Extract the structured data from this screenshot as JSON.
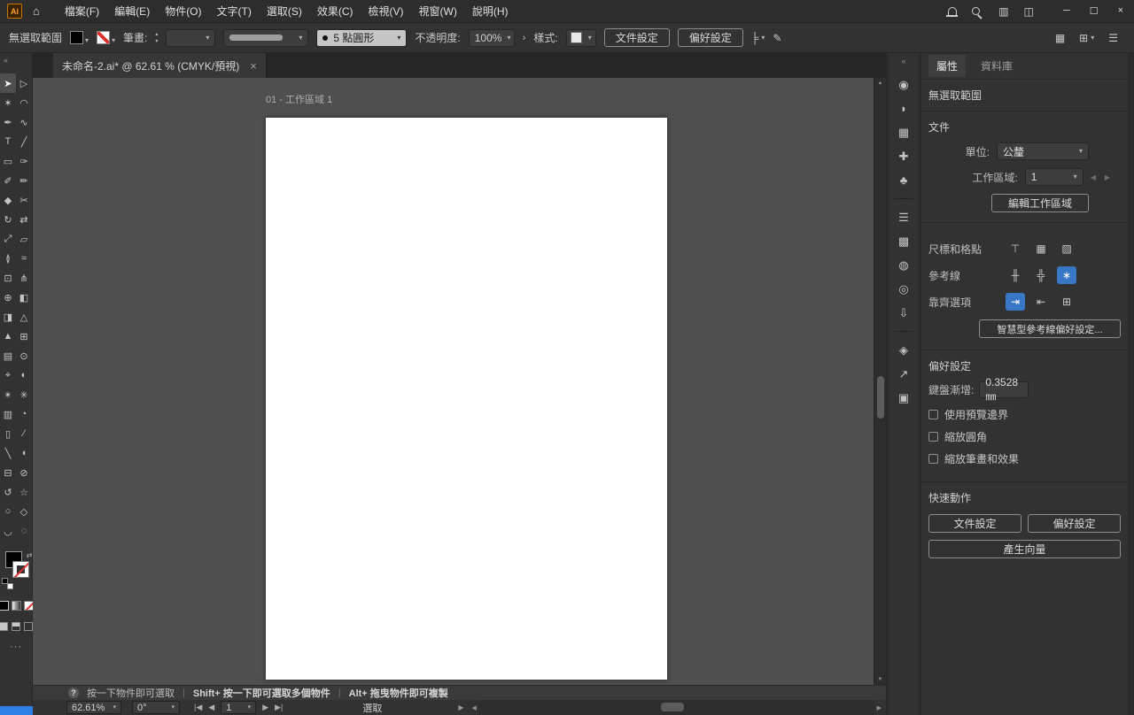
{
  "icons": {
    "logo": "Ai",
    "home": "⌂",
    "collapse": "«",
    "caret": "▾",
    "minimize": "─",
    "maximize": "☐",
    "close": "×",
    "tab_close": "×",
    "help": "?",
    "layout_a": "▥",
    "layout_b": "◫",
    "stepper_up": "▴",
    "stepper_down": "▾",
    "opacity_more": "›",
    "align": "╞",
    "edit": "✎",
    "arrange_documents": "▦",
    "workspace": "⊞",
    "bar_menu": "☰",
    "divider": "|",
    "nav_first": "|◀",
    "nav_prev": "◀",
    "nav_next": "▶",
    "nav_last": "▶|",
    "scroll_left": "◀",
    "scroll_right": "▶",
    "scroll_up": "▲",
    "scroll_down": "▼",
    "panel_prev": "◀",
    "panel_next": "▶",
    "swap": "⇄",
    "ellipsis": "···"
  },
  "menubar": {
    "items": [
      "檔案(F)",
      "編輯(E)",
      "物件(O)",
      "文字(T)",
      "選取(S)",
      "效果(C)",
      "檢視(V)",
      "視窗(W)",
      "說明(H)"
    ]
  },
  "control_bar": {
    "selection_label": "無選取範圍",
    "stroke_label": "筆畫:",
    "brush_value": "5 點圓形",
    "opacity_label": "不透明度:",
    "opacity_value": "100%",
    "style_label": "樣式:",
    "document_setup": "文件設定",
    "preferences": "偏好設定"
  },
  "document_tab": {
    "title": "未命名-2.ai* @ 62.61 % (CMYK/預視)"
  },
  "canvas": {
    "artboard_label": "01 - 工作區域 1"
  },
  "toolbar": {
    "tools": [
      {
        "name": "selection-tool",
        "glyph": "➤",
        "active": true
      },
      {
        "name": "direct-selection-tool",
        "glyph": "▷"
      },
      {
        "name": "magic-wand-tool",
        "glyph": "✶"
      },
      {
        "name": "lasso-tool",
        "glyph": "◠"
      },
      {
        "name": "pen-tool",
        "glyph": "✒"
      },
      {
        "name": "curvature-tool",
        "glyph": "∿"
      },
      {
        "name": "type-tool",
        "glyph": "T"
      },
      {
        "name": "line-segment-tool",
        "glyph": "╱"
      },
      {
        "name": "rectangle-tool",
        "glyph": "▭"
      },
      {
        "name": "paintbrush-tool",
        "glyph": "✑"
      },
      {
        "name": "shaper-tool",
        "glyph": "✐"
      },
      {
        "name": "pencil-tool",
        "glyph": "✏"
      },
      {
        "name": "eraser-tool",
        "glyph": "◆"
      },
      {
        "name": "scissors-tool",
        "glyph": "✂"
      },
      {
        "name": "rotate-tool",
        "glyph": "↻"
      },
      {
        "name": "reflect-tool",
        "glyph": "⇄"
      },
      {
        "name": "scale-tool",
        "glyph": "⤢"
      },
      {
        "name": "shear-tool",
        "glyph": "▱"
      },
      {
        "name": "width-tool",
        "glyph": "≬"
      },
      {
        "name": "warp-tool",
        "glyph": "≈"
      },
      {
        "name": "free-transform-tool",
        "glyph": "⊡"
      },
      {
        "name": "puppet-warp-tool",
        "glyph": "⋔"
      },
      {
        "name": "shape-builder-tool",
        "glyph": "⊕"
      },
      {
        "name": "live-paint-bucket-tool",
        "glyph": "◧"
      },
      {
        "name": "live-paint-selection-tool",
        "glyph": "◨"
      },
      {
        "name": "perspective-grid-tool",
        "glyph": "△"
      },
      {
        "name": "perspective-selection-tool",
        "glyph": "▲"
      },
      {
        "name": "mesh-tool",
        "glyph": "⊞"
      },
      {
        "name": "gradient-tool",
        "glyph": "▤"
      },
      {
        "name": "eyedropper-tool",
        "glyph": "⊙"
      },
      {
        "name": "measure-tool",
        "glyph": "⌖"
      },
      {
        "name": "blend-tool",
        "glyph": "◐"
      },
      {
        "name": "symbol-sprayer-tool",
        "glyph": "✴"
      },
      {
        "name": "symbol-shifter-tool",
        "glyph": "✳"
      },
      {
        "name": "column-graph-tool",
        "glyph": "▥"
      },
      {
        "name": "pie-graph-tool",
        "glyph": "◔"
      },
      {
        "name": "artboard-tool",
        "glyph": "▯"
      },
      {
        "name": "slice-tool",
        "glyph": "∕"
      },
      {
        "name": "knife-tool",
        "glyph": "╲"
      },
      {
        "name": "hand-tool",
        "glyph": "◖"
      },
      {
        "name": "print-tiling-tool",
        "glyph": "⊟"
      },
      {
        "name": "zoom-tool",
        "glyph": "⊘"
      },
      {
        "name": "rotate-view-tool",
        "glyph": "↺"
      },
      {
        "name": "star-tool",
        "glyph": "☆"
      },
      {
        "name": "ellipse-tool",
        "glyph": "○"
      },
      {
        "name": "polygon-tool",
        "glyph": "◇"
      },
      {
        "name": "arc-tool",
        "glyph": "◡"
      },
      {
        "name": "spiral-tool",
        "glyph": "◌"
      }
    ]
  },
  "dock_strip": {
    "icons": [
      {
        "name": "color-wheel-icon",
        "glyph": "◉"
      },
      {
        "name": "shapes-icon",
        "glyph": "◗"
      },
      {
        "name": "artboards-icon",
        "glyph": "▦"
      },
      {
        "name": "adjustments-icon",
        "glyph": "✚"
      },
      {
        "name": "symbols-icon",
        "glyph": "♣"
      },
      {
        "sep": true
      },
      {
        "name": "stroke-icon",
        "glyph": "☰"
      },
      {
        "name": "swatches-icon",
        "glyph": "▩"
      },
      {
        "name": "globe-icon",
        "glyph": "◍"
      },
      {
        "name": "gradient-icon",
        "glyph": "◎"
      },
      {
        "name": "asset-export-icon",
        "glyph": "⇩"
      },
      {
        "sep": true
      },
      {
        "name": "layers-icon",
        "glyph": "◈"
      },
      {
        "name": "share-icon",
        "glyph": "↗"
      },
      {
        "name": "documents-icon",
        "glyph": "▣"
      }
    ]
  },
  "panel": {
    "tabs": [
      {
        "label": "屬性",
        "active": true
      },
      {
        "label": "資料庫",
        "active": false
      }
    ],
    "no_selection": "無選取範圍",
    "document": {
      "title": "文件",
      "unit_label": "單位:",
      "unit_value": "公釐",
      "artboard_label": "工作區域:",
      "artboard_value": "1",
      "edit_artboards": "編輯工作區域",
      "rulers_label": "尺標和格點",
      "ruler_icons": [
        {
          "name": "show-rulers-icon",
          "glyph": "⊤"
        },
        {
          "name": "show-grid-icon",
          "glyph": "▦"
        },
        {
          "name": "transparency-grid-icon",
          "glyph": "▨"
        }
      ],
      "guides_label": "參考線",
      "guide_icons": [
        {
          "name": "show-guides-icon",
          "glyph": "╫"
        },
        {
          "name": "lock-guides-icon",
          "glyph": "╬"
        },
        {
          "name": "smart-guides-icon",
          "glyph": "∗",
          "active": true
        }
      ],
      "snap_label": "靠齊選項",
      "snap_icons": [
        {
          "name": "snap-to-point-icon",
          "glyph": "⇥",
          "active": true
        },
        {
          "name": "snap-to-grid-icon",
          "glyph": "⇤"
        },
        {
          "name": "snap-to-pixel-icon",
          "glyph": "⊞"
        }
      ],
      "smart_guides_button": "智慧型參考線偏好設定..."
    },
    "preferences": {
      "title": "偏好設定",
      "keyboard_label": "鍵盤漸增:",
      "keyboard_value": "0.3528 ㎜",
      "checkboxes": [
        "使用預覽邊界",
        "縮放圓角",
        "縮放筆畫和效果"
      ]
    },
    "quick_actions": {
      "title": "快速動作",
      "buttons": [
        "文件設定",
        "偏好設定",
        "產生向量"
      ]
    }
  },
  "status_bar": {
    "hints": [
      "按一下物件即可選取",
      "Shift+ 按一下即可選取多個物件",
      "Alt+ 拖曳物件即可複製"
    ],
    "zoom": "62.61%",
    "rotation": "0°",
    "artboard_number": "1",
    "tool_label": "選取"
  }
}
